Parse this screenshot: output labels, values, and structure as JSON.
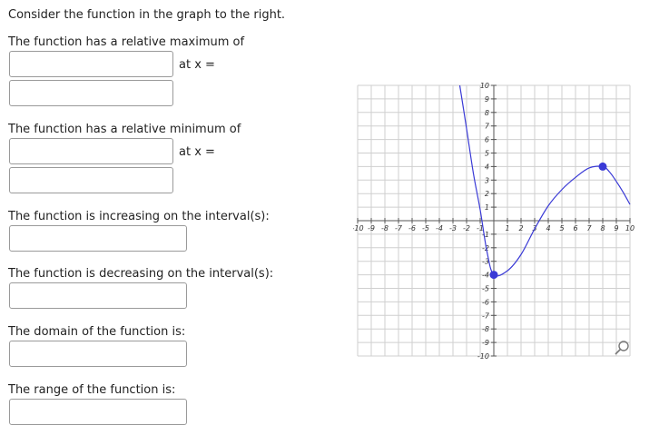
{
  "prompt": "Consider the function in the graph to the right.",
  "rel_max_label": "The function has a relative maximum of",
  "rel_min_label": "The function has a relative minimum of",
  "at_x_label": "at x =",
  "increasing_label": "The function is increasing on the interval(s):",
  "decreasing_label": "The function is decreasing on the interval(s):",
  "domain_label": "The domain of the function is:",
  "range_label": "The range of the function is:",
  "inputs": {
    "max_value": "",
    "max_x": "",
    "min_value": "",
    "min_x": "",
    "increasing": "",
    "decreasing": "",
    "domain": "",
    "range": ""
  },
  "colors": {
    "curve": "#3a3ad6",
    "grid": "#cfcfcf",
    "axis": "#555555"
  },
  "zoom_icon": "magnifier-icon",
  "chart_data": {
    "type": "line",
    "xlim": [
      -10,
      10
    ],
    "ylim": [
      -10,
      10
    ],
    "grid": true,
    "x_tick_labels": [
      "-10",
      "-9",
      "-8",
      "-7",
      "-6",
      "-5",
      "-4",
      "-3",
      "-2",
      "-1",
      "1",
      "2",
      "3",
      "4",
      "5",
      "6",
      "7",
      "8",
      "9",
      "10"
    ],
    "y_tick_labels": [
      "10",
      "9",
      "8",
      "7",
      "6",
      "5",
      "4",
      "3",
      "2",
      "1",
      "-1",
      "-2",
      "-3",
      "-4",
      "-5",
      "-6",
      "-7",
      "-8",
      "-9",
      "-10"
    ],
    "series": [
      {
        "x": [
          -2.5,
          -2,
          -1.5,
          -1,
          -0.5,
          0,
          1,
          2,
          3,
          4,
          5,
          6,
          7,
          8,
          8.5,
          9,
          9.5,
          10
        ],
        "y": [
          10,
          6.8,
          3.5,
          0.8,
          -2.3,
          -4,
          -3.7,
          -2.5,
          -0.6,
          1.1,
          2.3,
          3.2,
          3.9,
          4,
          3.6,
          2.9,
          2.1,
          1.2
        ]
      }
    ],
    "points": [
      {
        "x": 0,
        "y": -4
      },
      {
        "x": 8,
        "y": 4
      }
    ]
  }
}
